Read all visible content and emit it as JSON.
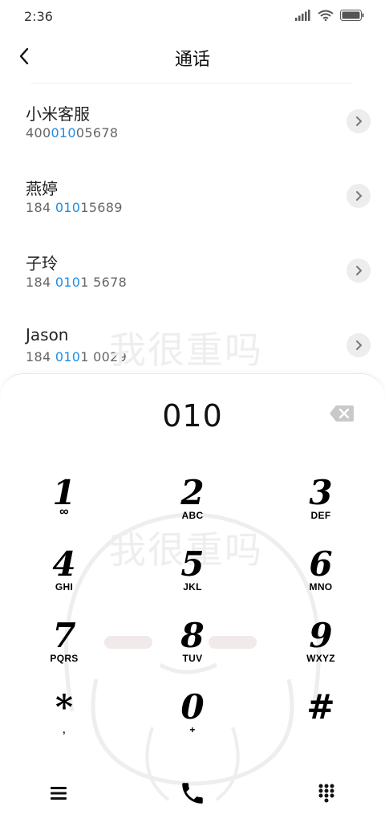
{
  "status_bar": {
    "time": "2:36"
  },
  "header": {
    "title": "通话"
  },
  "contacts": [
    {
      "name": "小米客服",
      "num_pre": "400",
      "num_hl": "010",
      "num_post": "05678"
    },
    {
      "name": "燕婷",
      "num_pre": "184 ",
      "num_hl": "010",
      "num_post": "15689"
    },
    {
      "name": "子玲",
      "num_pre": "184 ",
      "num_hl": "010",
      "num_post": "1 5678"
    },
    {
      "name": "Jason",
      "num_pre": "184 ",
      "num_hl": "010",
      "num_post": "1 0029"
    }
  ],
  "watermark": {
    "text": "我很重吗"
  },
  "dialpad": {
    "input_value": "010",
    "keys": [
      {
        "digit": "1",
        "letters": "∞"
      },
      {
        "digit": "2",
        "letters": "ABC"
      },
      {
        "digit": "3",
        "letters": "DEF"
      },
      {
        "digit": "4",
        "letters": "GHI"
      },
      {
        "digit": "5",
        "letters": "JKL"
      },
      {
        "digit": "6",
        "letters": "MNO"
      },
      {
        "digit": "7",
        "letters": "PQRS"
      },
      {
        "digit": "8",
        "letters": "TUV"
      },
      {
        "digit": "9",
        "letters": "WXYZ"
      },
      {
        "digit": "*",
        "letters": ","
      },
      {
        "digit": "0",
        "letters": "+"
      },
      {
        "digit": "#",
        "letters": ""
      }
    ]
  },
  "icons": {
    "signal": "signal-icon",
    "wifi": "wifi-icon",
    "battery": "battery-icon",
    "back": "back-arrow-icon",
    "chevron": "chevron-right-icon",
    "backspace": "backspace-icon",
    "menu": "menu-icon",
    "call": "phone-icon",
    "dialpad": "dialpad-icon"
  },
  "colors": {
    "highlight": "#1e8ce6",
    "chevron_bg": "#ededed"
  }
}
